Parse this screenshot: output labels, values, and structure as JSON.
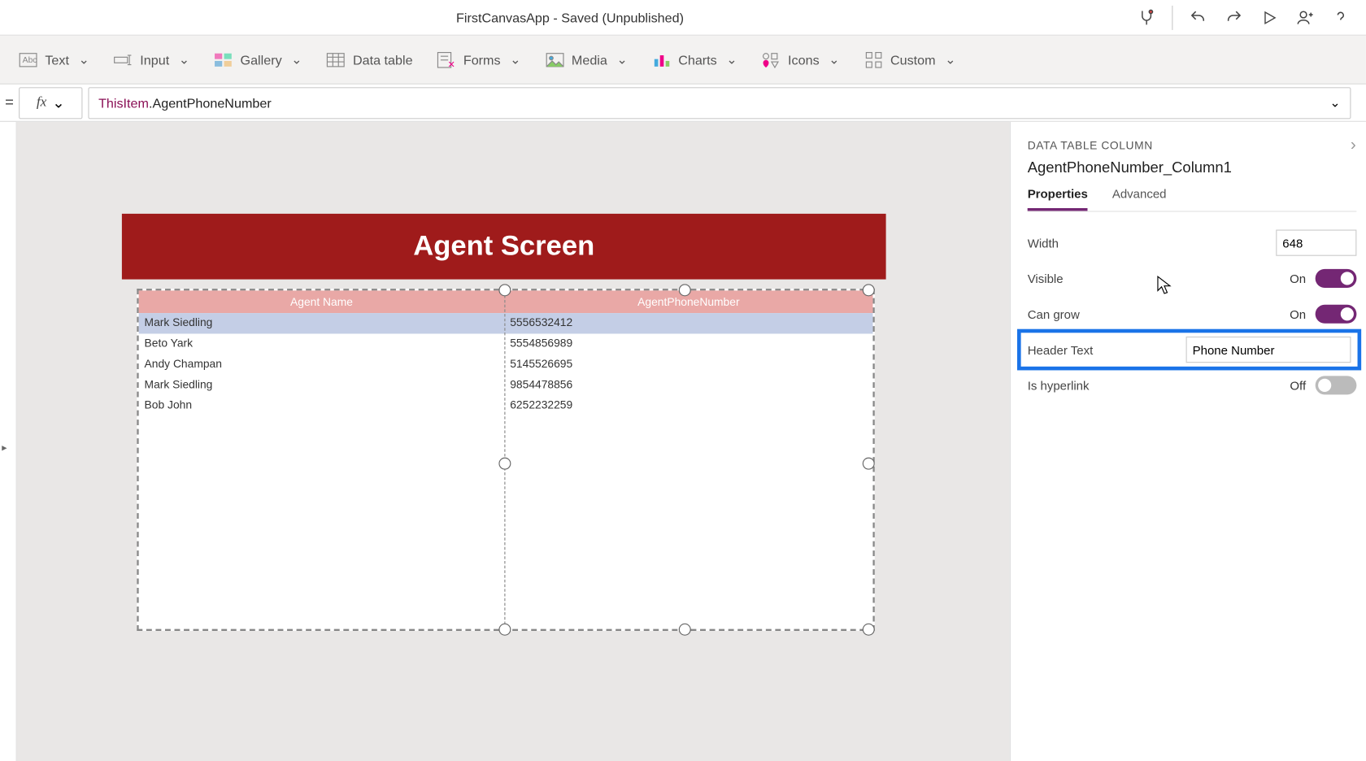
{
  "titlebar": {
    "app_title": "FirstCanvasApp - Saved (Unpublished)"
  },
  "ribbon": {
    "text": "Text",
    "input": "Input",
    "gallery": "Gallery",
    "data_table": "Data table",
    "forms": "Forms",
    "media": "Media",
    "charts": "Charts",
    "icons": "Icons",
    "custom": "Custom"
  },
  "formula": {
    "this": "ThisItem",
    "rest": ".AgentPhoneNumber"
  },
  "canvas": {
    "header": "Agent Screen",
    "columns": [
      "Agent Name",
      "AgentPhoneNumber"
    ],
    "rows": [
      [
        "Mark Siedling",
        "5556532412"
      ],
      [
        "Beto Yark",
        "5554856989"
      ],
      [
        "Andy Champan",
        "5145526695"
      ],
      [
        "Mark Siedling",
        "9854478856"
      ],
      [
        "Bob John",
        "6252232259"
      ]
    ]
  },
  "props": {
    "section": "DATA TABLE COLUMN",
    "name": "AgentPhoneNumber_Column1",
    "tabs": {
      "properties": "Properties",
      "advanced": "Advanced"
    },
    "width_label": "Width",
    "width_value": "648",
    "visible_label": "Visible",
    "visible_state": "On",
    "cangrow_label": "Can grow",
    "cangrow_state": "On",
    "header_label": "Header Text",
    "header_value": "Phone Number",
    "hyperlink_label": "Is hyperlink",
    "hyperlink_state": "Off"
  }
}
